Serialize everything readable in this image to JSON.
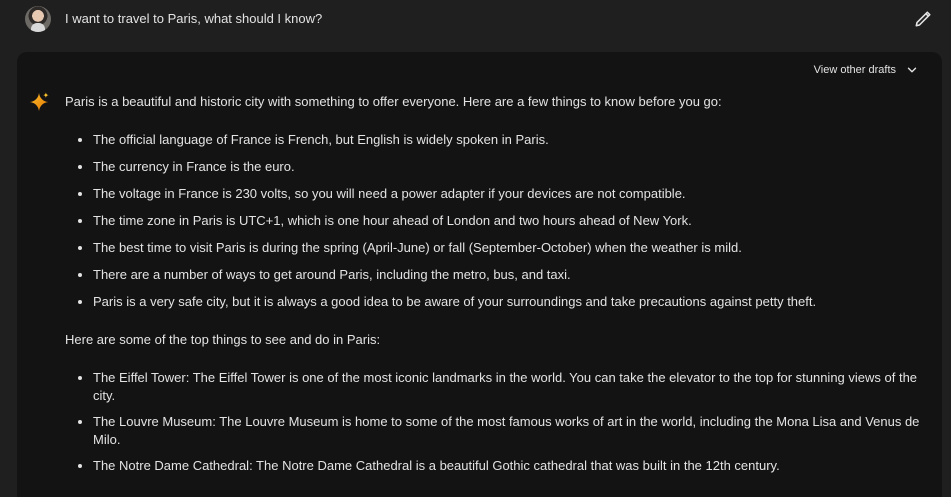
{
  "user_prompt": {
    "text": "I want to travel to Paris, what should I know?"
  },
  "response": {
    "drafts_label": "View other drafts",
    "intro": "Paris is a beautiful and historic city with something to offer everyone. Here are a few things to know before you go:",
    "facts": [
      "The official language of France is French, but English is widely spoken in Paris.",
      "The currency in France is the euro.",
      "The voltage in France is 230 volts, so you will need a power adapter if your devices are not compatible.",
      "The time zone in Paris is UTC+1, which is one hour ahead of London and two hours ahead of New York.",
      "The best time to visit Paris is during the spring (April-June) or fall (September-October) when the weather is mild.",
      "There are a number of ways to get around Paris, including the metro, bus, and taxi.",
      "Paris is a very safe city, but it is always a good idea to be aware of your surroundings and take precautions against petty theft."
    ],
    "things_heading": "Here are some of the top things to see and do in Paris:",
    "things": [
      "The Eiffel Tower: The Eiffel Tower is one of the most iconic landmarks in the world. You can take the elevator to the top for stunning views of the city.",
      "The Louvre Museum: The Louvre Museum is home to some of the most famous works of art in the world, including the Mona Lisa and Venus de Milo.",
      "The Notre Dame Cathedral: The Notre Dame Cathedral is a beautiful Gothic cathedral that was built in the 12th century."
    ]
  },
  "icons": {
    "avatar": "user-avatar",
    "edit": "pencil-icon",
    "drafts_toggle": "chevron-down-icon",
    "assistant": "sparkle-icon"
  },
  "colors": {
    "background": "#1f1f1f",
    "card": "#131314",
    "text": "#e3e3e3",
    "sparkle_start": "#f9ab00",
    "sparkle_end": "#e37400"
  }
}
